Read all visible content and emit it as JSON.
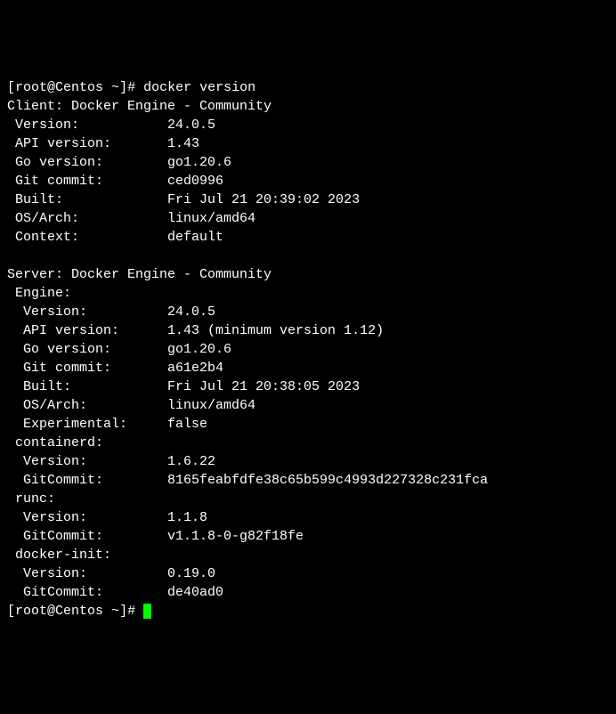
{
  "prompt": {
    "open": "[",
    "user_host": "root@Centos",
    "path": " ~",
    "close": "]# ",
    "command": "docker version"
  },
  "client": {
    "header": "Client: Docker Engine - Community",
    "rows": [
      {
        "label": " Version:           ",
        "value": "24.0.5"
      },
      {
        "label": " API version:       ",
        "value": "1.43"
      },
      {
        "label": " Go version:        ",
        "value": "go1.20.6"
      },
      {
        "label": " Git commit:        ",
        "value": "ced0996"
      },
      {
        "label": " Built:             ",
        "value": "Fri Jul 21 20:39:02 2023"
      },
      {
        "label": " OS/Arch:           ",
        "value": "linux/amd64"
      },
      {
        "label": " Context:           ",
        "value": "default"
      }
    ]
  },
  "blank": " ",
  "server": {
    "header": "Server: Docker Engine - Community",
    "components": [
      {
        "name": " Engine:",
        "rows": [
          {
            "label": "  Version:          ",
            "value": "24.0.5"
          },
          {
            "label": "  API version:      ",
            "value": "1.43 (minimum version 1.12)"
          },
          {
            "label": "  Go version:       ",
            "value": "go1.20.6"
          },
          {
            "label": "  Git commit:       ",
            "value": "a61e2b4"
          },
          {
            "label": "  Built:            ",
            "value": "Fri Jul 21 20:38:05 2023"
          },
          {
            "label": "  OS/Arch:          ",
            "value": "linux/amd64"
          },
          {
            "label": "  Experimental:     ",
            "value": "false"
          }
        ]
      },
      {
        "name": " containerd:",
        "rows": [
          {
            "label": "  Version:          ",
            "value": "1.6.22"
          },
          {
            "label": "  GitCommit:        ",
            "value": "8165feabfdfe38c65b599c4993d227328c231fca"
          }
        ]
      },
      {
        "name": " runc:",
        "rows": [
          {
            "label": "  Version:          ",
            "value": "1.1.8"
          },
          {
            "label": "  GitCommit:        ",
            "value": "v1.1.8-0-g82f18fe"
          }
        ]
      },
      {
        "name": " docker-init:",
        "rows": [
          {
            "label": "  Version:          ",
            "value": "0.19.0"
          },
          {
            "label": "  GitCommit:        ",
            "value": "de40ad0"
          }
        ]
      }
    ]
  },
  "prompt2": {
    "open": "[",
    "user_host": "root@Centos",
    "path": " ~",
    "close": "]# "
  }
}
